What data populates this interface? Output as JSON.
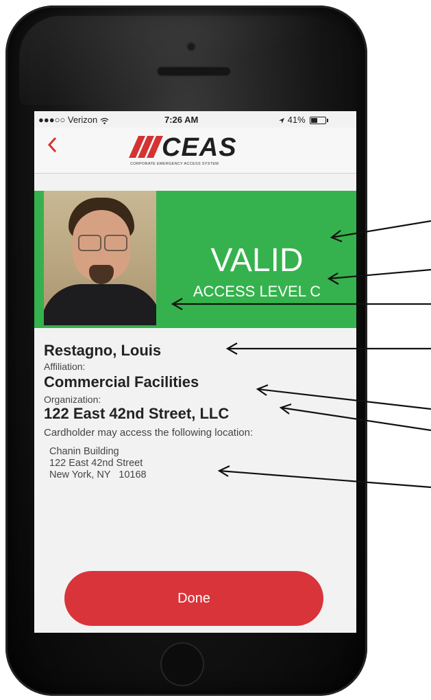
{
  "status_bar": {
    "carrier": "●●●○○ Verizon",
    "wifi_icon": "wifi-icon",
    "time": "7:26 AM",
    "location_icon": "location-arrow-icon",
    "battery_percent": "41%",
    "battery_level": 0.41
  },
  "nav": {
    "back_icon": "chevron-left-icon",
    "logo_word": "CEAS",
    "logo_tagline": "CORPORATE EMERGENCY ACCESS SYSTEM"
  },
  "credential": {
    "status": "VALID",
    "access_level": "ACCESS LEVEL C",
    "name": "Restagno, Louis",
    "affiliation_label": "Affiliation:",
    "affiliation": "Commercial Facilities",
    "organization_label": "Organization:",
    "organization": "122 East 42nd Street, LLC",
    "access_note": "Cardholder may access the following location:",
    "location": {
      "line1": "Chanin Building",
      "line2": "122 East 42nd Street",
      "line3": "New York, NY   10168"
    }
  },
  "actions": {
    "done_label": "Done"
  },
  "colors": {
    "valid_green": "#35b24d",
    "accent_red": "#d33333",
    "done_red": "#d9343a"
  }
}
